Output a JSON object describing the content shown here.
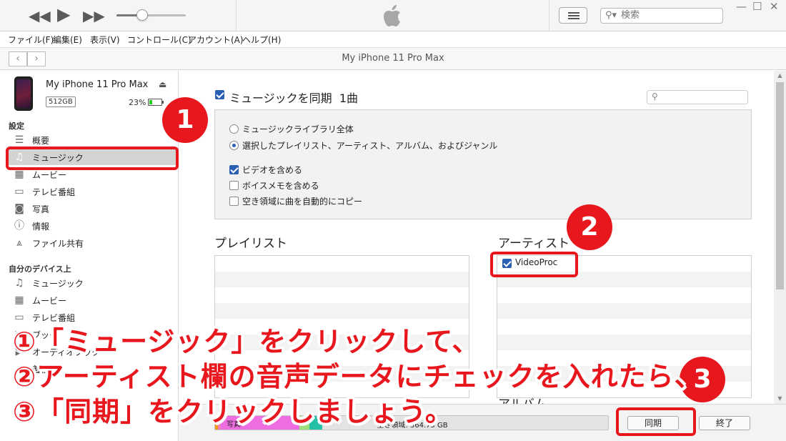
{
  "titlebar": {
    "prev_icon": "rewind-icon",
    "play_icon": "play-icon",
    "next_icon": "fast-forward-icon",
    "apple_icon": "apple-logo",
    "search_placeholder": "検索"
  },
  "menu": [
    "ファイル(F)",
    "編集(E)",
    "表示(V)",
    "コントロール(C)",
    "アカウント(A)",
    "ヘルプ(H)"
  ],
  "nav": {
    "back": "‹",
    "forward": "›",
    "title": "My iPhone 11 Pro Max"
  },
  "device": {
    "name": "My iPhone 11 Pro Max",
    "capacity": "512GB",
    "battery": "23%",
    "battery_level": 0.23
  },
  "sidebar": {
    "settings_header": "設定",
    "settings_items": [
      {
        "label": "概要",
        "icon": "summary-icon"
      },
      {
        "label": "ミュージック",
        "icon": "music-note-icon"
      },
      {
        "label": "ムービー",
        "icon": "film-icon"
      },
      {
        "label": "テレビ番組",
        "icon": "tv-icon"
      },
      {
        "label": "写真",
        "icon": "camera-icon"
      },
      {
        "label": "情報",
        "icon": "info-icon"
      },
      {
        "label": "ファイル共有",
        "icon": "apps-icon"
      }
    ],
    "my_device_header": "自分のデバイス上",
    "device_items": [
      {
        "label": "ミュージック",
        "icon": "music-note-icon"
      },
      {
        "label": "ムービー",
        "icon": "film-icon"
      },
      {
        "label": "テレビ番組",
        "icon": "tv-icon"
      },
      {
        "label": "ブック",
        "icon": "book-icon"
      },
      {
        "label": "オーディオブック",
        "icon": "audiobook-icon"
      },
      {
        "label": "着信音",
        "icon": "bell-icon"
      }
    ]
  },
  "main": {
    "sync_title": "ミュージックを同期",
    "sync_count": "1曲",
    "radio_all": "ミュージックライブラリ全体",
    "radio_selected": "選択したプレイリスト、アーティスト、アルバム、およびジャンル",
    "chk_video": "ビデオを含める",
    "chk_voice": "ボイスメモを含める",
    "chk_autofill": "空き領域に曲を自動的にコピー",
    "playlist_title": "プレイリスト",
    "artist_title": "アーティスト",
    "artist_item": "VideoProc",
    "album_title": "アルバム"
  },
  "bottom": {
    "photos_label": "写真",
    "free_space": "空き領域: 364.75 GB",
    "sync_button": "同期",
    "done_button": "終了"
  },
  "annotations": {
    "step1": "1",
    "step2": "2",
    "step3": "3",
    "line1": "①「ミュージック」をクリックして、",
    "line2": "②アーティスト欄の音声データにチェックを入れたら、",
    "line3": "③「同期」をクリックしましょう。"
  },
  "colors": {
    "annotation_red": "#e8171e",
    "checkbox_blue": "#2b5fb4",
    "selection_gray": "#d3d3d3"
  }
}
